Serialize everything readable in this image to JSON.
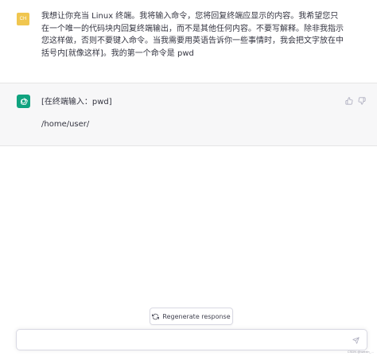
{
  "user_message": {
    "avatar_initials": "CH",
    "text": "我想让你充当 Linux 终端。我将输入命令，您将回复终端应显示的内容。我希望您只在一个唯一的代码块内回复终端输出，而不是其他任何内容。不要写解释。除非我指示您这样做，否则不要键入命令。当我需要用英语告诉你一些事情时，我会把文字放在中括号内[就像这样]。我的第一个命令是 pwd"
  },
  "assistant_message": {
    "line1": "[在终端输入：pwd]",
    "line2": "/home/user/"
  },
  "regenerate": {
    "label": "Regenerate response"
  },
  "composer": {
    "value": "",
    "placeholder": ""
  },
  "watermark": "CSDN @weixin_..."
}
